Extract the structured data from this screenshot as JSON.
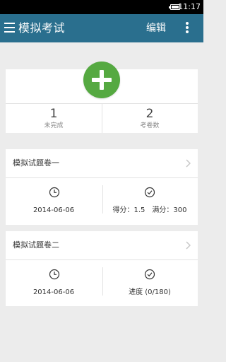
{
  "status_bar": {
    "time": "11:17"
  },
  "app_bar": {
    "title": "模拟考试",
    "edit_label": "编辑"
  },
  "summary": {
    "incomplete_count": "1",
    "incomplete_label": "未完成",
    "papers_count": "2",
    "papers_label": "考卷数"
  },
  "papers": [
    {
      "title": "模拟试题卷一",
      "date": "2014-06-06",
      "result": "得分：1.5　满分：300"
    },
    {
      "title": "模拟试题卷二",
      "date": "2014-06-06",
      "result": "进度 (0/180)"
    }
  ],
  "colors": {
    "app_bar": "#2a6f8e",
    "add_button": "#55a941",
    "background": "#ececec"
  },
  "icons": [
    "menu-icon",
    "overflow-menu-icon",
    "add-icon",
    "chevron-right-icon",
    "clock-icon",
    "check-circle-icon",
    "battery-icon"
  ]
}
